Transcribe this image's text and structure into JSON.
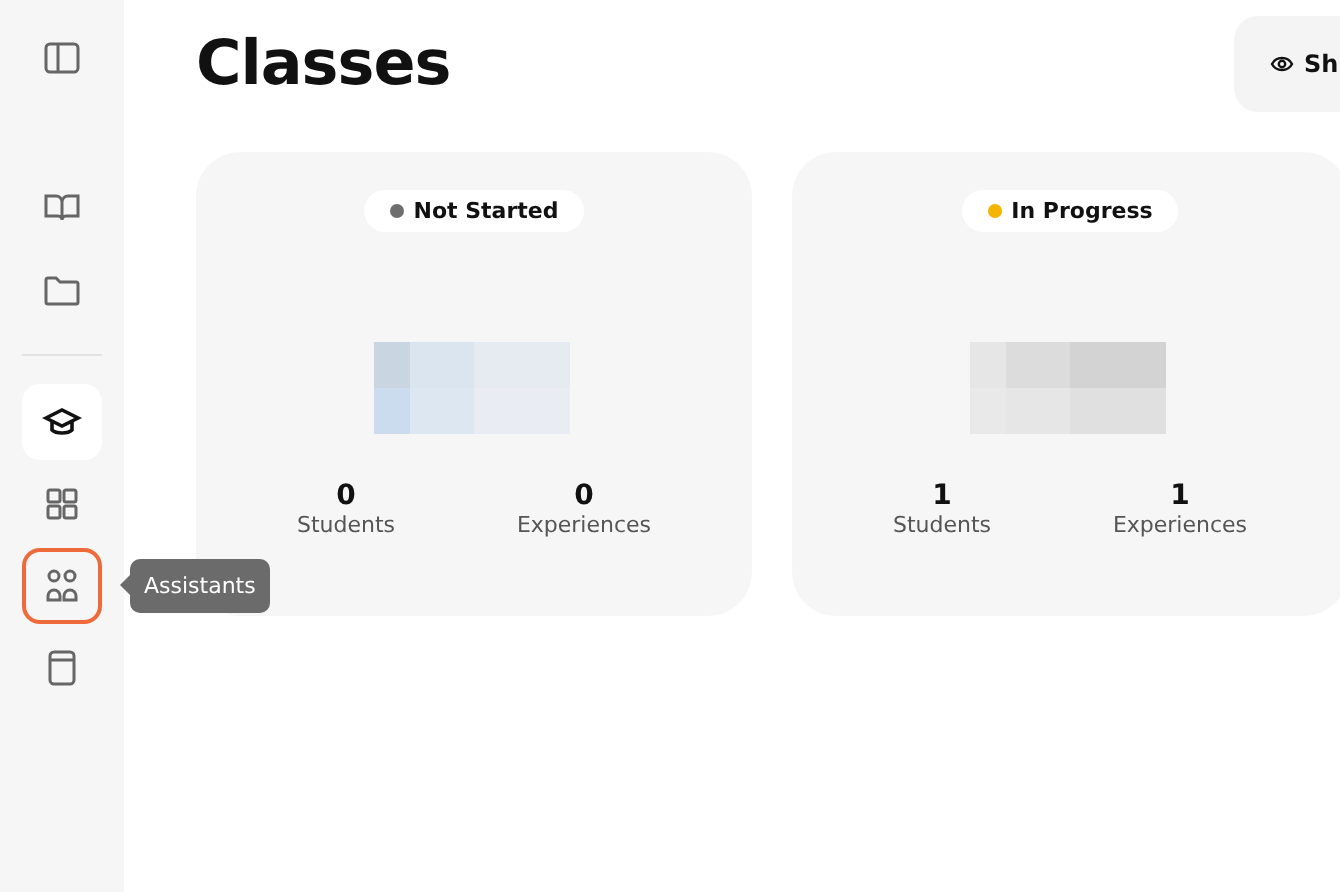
{
  "sidebar": {
    "items": [
      {
        "kind": "toggle",
        "selected": false,
        "focused": false
      },
      {
        "kind": "divider-gap"
      },
      {
        "kind": "book",
        "selected": false,
        "focused": false
      },
      {
        "kind": "folder",
        "selected": false,
        "focused": false
      },
      {
        "kind": "divider"
      },
      {
        "kind": "cap",
        "selected": true,
        "focused": false
      },
      {
        "kind": "grid",
        "selected": false,
        "focused": false
      },
      {
        "kind": "people",
        "selected": false,
        "focused": true,
        "tooltip": "Assistants"
      },
      {
        "kind": "notebook",
        "selected": false,
        "focused": false
      }
    ]
  },
  "page": {
    "title": "Classes",
    "button": "Sh"
  },
  "cards": [
    {
      "status": "Not Started",
      "color": "#6e6e6e",
      "students": "0",
      "students_label": "Students",
      "experiences": "0",
      "experiences_label": "Experiences"
    },
    {
      "status": "In Progress",
      "color": "#f5b400",
      "students": "1",
      "students_label": "Students",
      "experiences": "1",
      "experiences_label": "Experiences"
    }
  ]
}
